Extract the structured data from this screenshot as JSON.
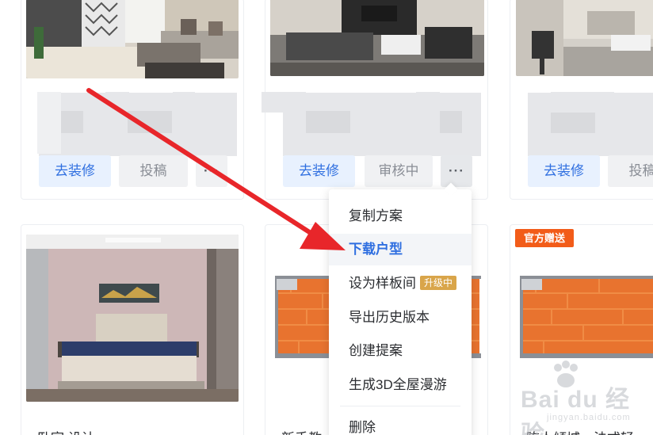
{
  "top_cards": [
    {
      "renovate_label": "去装修",
      "submit_label": "投稿",
      "more_label": "···"
    },
    {
      "renovate_label": "去装修",
      "status_label": "审核中",
      "more_label": "···"
    },
    {
      "renovate_label": "去装修",
      "submit_label": "投稿"
    }
  ],
  "context_menu": {
    "items": [
      {
        "label": "复制方案"
      },
      {
        "label": "下载户型"
      },
      {
        "label": "设为样板间",
        "badge": "升级中"
      },
      {
        "label": "导出历史版本"
      },
      {
        "label": "创建提案"
      },
      {
        "label": "生成3D全屋漫游"
      },
      {
        "label": "删除"
      }
    ]
  },
  "bottom_cards": [
    {
      "title": "卧室 设计"
    },
    {
      "title": "新手教"
    },
    {
      "tag": "官方赠送",
      "title": "陈人倾城，法式轻"
    }
  ],
  "watermark": {
    "brand": "Bai du 经验",
    "sub": "jingyan.baidu.com"
  },
  "colors": {
    "accent_blue": "#2f6fe0",
    "arrow_red": "#e8262a",
    "tag_orange": "#f25c19",
    "badge_gold": "#d9a54a"
  }
}
